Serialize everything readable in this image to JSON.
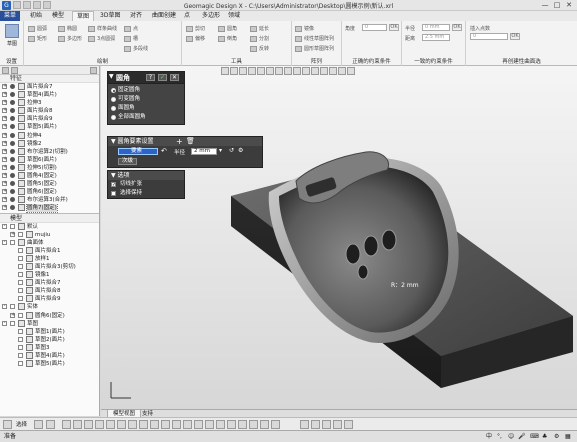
{
  "window": {
    "title": "Geomagic Design X - C:\\Users\\Administrator\\Desktop\\圆模示例\\新认.xrl"
  },
  "ribbon_tabs": [
    {
      "label": "菜单"
    },
    {
      "label": "初始"
    },
    {
      "label": "模型"
    },
    {
      "label": "草图"
    },
    {
      "label": "3D草图"
    },
    {
      "label": "对齐"
    },
    {
      "label": "曲面创建"
    },
    {
      "label": "点"
    },
    {
      "label": "多边形"
    },
    {
      "label": "领域"
    }
  ],
  "ribbon": {
    "sketch_btn": "草图",
    "group_settings": "设置",
    "group_draw": "绘制",
    "group_tools": "工具",
    "group_array": "阵列",
    "group_normal_constraint": "正确的约束条件",
    "group_general_constraint": "一致的约束条件",
    "group_common": "再创建性曲面选",
    "draw_items": [
      "圆弧",
      "椭圆",
      "样条曲线",
      "矩形",
      "多边形",
      "3点圆弧",
      "点",
      "槽",
      "多段线"
    ],
    "tools_items": [
      "剪切",
      "偏移",
      "圆角",
      "倒角",
      "延长",
      "分割",
      "反转"
    ],
    "array_items": [
      "镜像",
      "线性草图阵列",
      "圆形草图阵列"
    ],
    "angle_label": "角度",
    "radius_label": "半径",
    "offset_label": "距离",
    "field_angle": "0",
    "field_r1": "0 mm",
    "field_r2": "2.5 mm",
    "field_d": "0 mm",
    "ok": "OK",
    "insert_label": "插入点数",
    "field_insert": "0"
  },
  "panel": {
    "feature_header": "特征",
    "features": [
      {
        "label": "面片拟合7",
        "expander": "+"
      },
      {
        "label": "草图4(面片)",
        "expander": "+"
      },
      {
        "label": "拉伸3",
        "expander": "+"
      },
      {
        "label": "面片拟合8",
        "expander": "+"
      },
      {
        "label": "面片拟合9",
        "expander": "+"
      },
      {
        "label": "草图5(面片)",
        "expander": "+"
      },
      {
        "label": "拉伸4",
        "expander": "+"
      },
      {
        "label": "镜像2",
        "expander": "+"
      },
      {
        "label": "布尔运算2(切割)",
        "expander": "+"
      },
      {
        "label": "草图6(面片)",
        "expander": "+"
      },
      {
        "label": "拉伸5(切割)",
        "expander": "+"
      },
      {
        "label": "圆角4(固定)",
        "expander": "+"
      },
      {
        "label": "圆角5(固定)",
        "expander": "+"
      },
      {
        "label": "圆角6(固定)",
        "expander": "+"
      },
      {
        "label": "布尔运算3(合并)",
        "expander": "+"
      },
      {
        "label": "圆角7(固定)",
        "expander": "+"
      }
    ],
    "model_header": "模型",
    "model_tree": [
      {
        "label": "默认",
        "indent": 0,
        "expander": "-"
      },
      {
        "label": "mujiu",
        "indent": 1,
        "expander": "+"
      },
      {
        "label": "曲面体",
        "indent": 0,
        "expander": "-"
      },
      {
        "label": "面片拟合1",
        "indent": 1,
        "expander": ""
      },
      {
        "label": "放样1",
        "indent": 1,
        "expander": ""
      },
      {
        "label": "面片拟合3(剪切)",
        "indent": 1,
        "expander": ""
      },
      {
        "label": "镜像1",
        "indent": 1,
        "expander": ""
      },
      {
        "label": "面片拟合7",
        "indent": 1,
        "expander": ""
      },
      {
        "label": "面片拟合8",
        "indent": 1,
        "expander": ""
      },
      {
        "label": "面片拟合9",
        "indent": 1,
        "expander": ""
      },
      {
        "label": "实体",
        "indent": 0,
        "expander": "-"
      },
      {
        "label": "圆角6(固定)",
        "indent": 1,
        "expander": "+"
      },
      {
        "label": "草图",
        "indent": 0,
        "expander": "-"
      },
      {
        "label": "草图1(面片)",
        "indent": 1,
        "expander": ""
      },
      {
        "label": "草图2(面片)",
        "indent": 1,
        "expander": ""
      },
      {
        "label": "草图3",
        "indent": 1,
        "expander": ""
      },
      {
        "label": "草图4(面片)",
        "indent": 1,
        "expander": ""
      },
      {
        "label": "草图5(面片)",
        "indent": 1,
        "expander": ""
      }
    ]
  },
  "dialog": {
    "title": "圆角",
    "options": [
      {
        "label": "固定圆角",
        "checked": true
      },
      {
        "label": "可变圆角",
        "checked": false
      },
      {
        "label": "面圆角",
        "checked": false
      },
      {
        "label": "全部面圆角",
        "checked": false
      }
    ],
    "elements_title": "圆角要素设置",
    "elements_field": "要素",
    "radius_label": "半径",
    "radius_value": "2 mm",
    "section_btn": "次级",
    "more_title": "选项",
    "tangent_label": "切线扩张",
    "tangent_checked": true,
    "preserve_label": "选择保持",
    "preserve_checked": false
  },
  "viewport": {
    "annotation": "R：2 mm"
  },
  "view_tabs": [
    {
      "label": "模型视图"
    },
    {
      "label": "支持"
    }
  ],
  "bottombar": {
    "select_mode": "选择"
  },
  "status": {
    "left": "准备"
  }
}
